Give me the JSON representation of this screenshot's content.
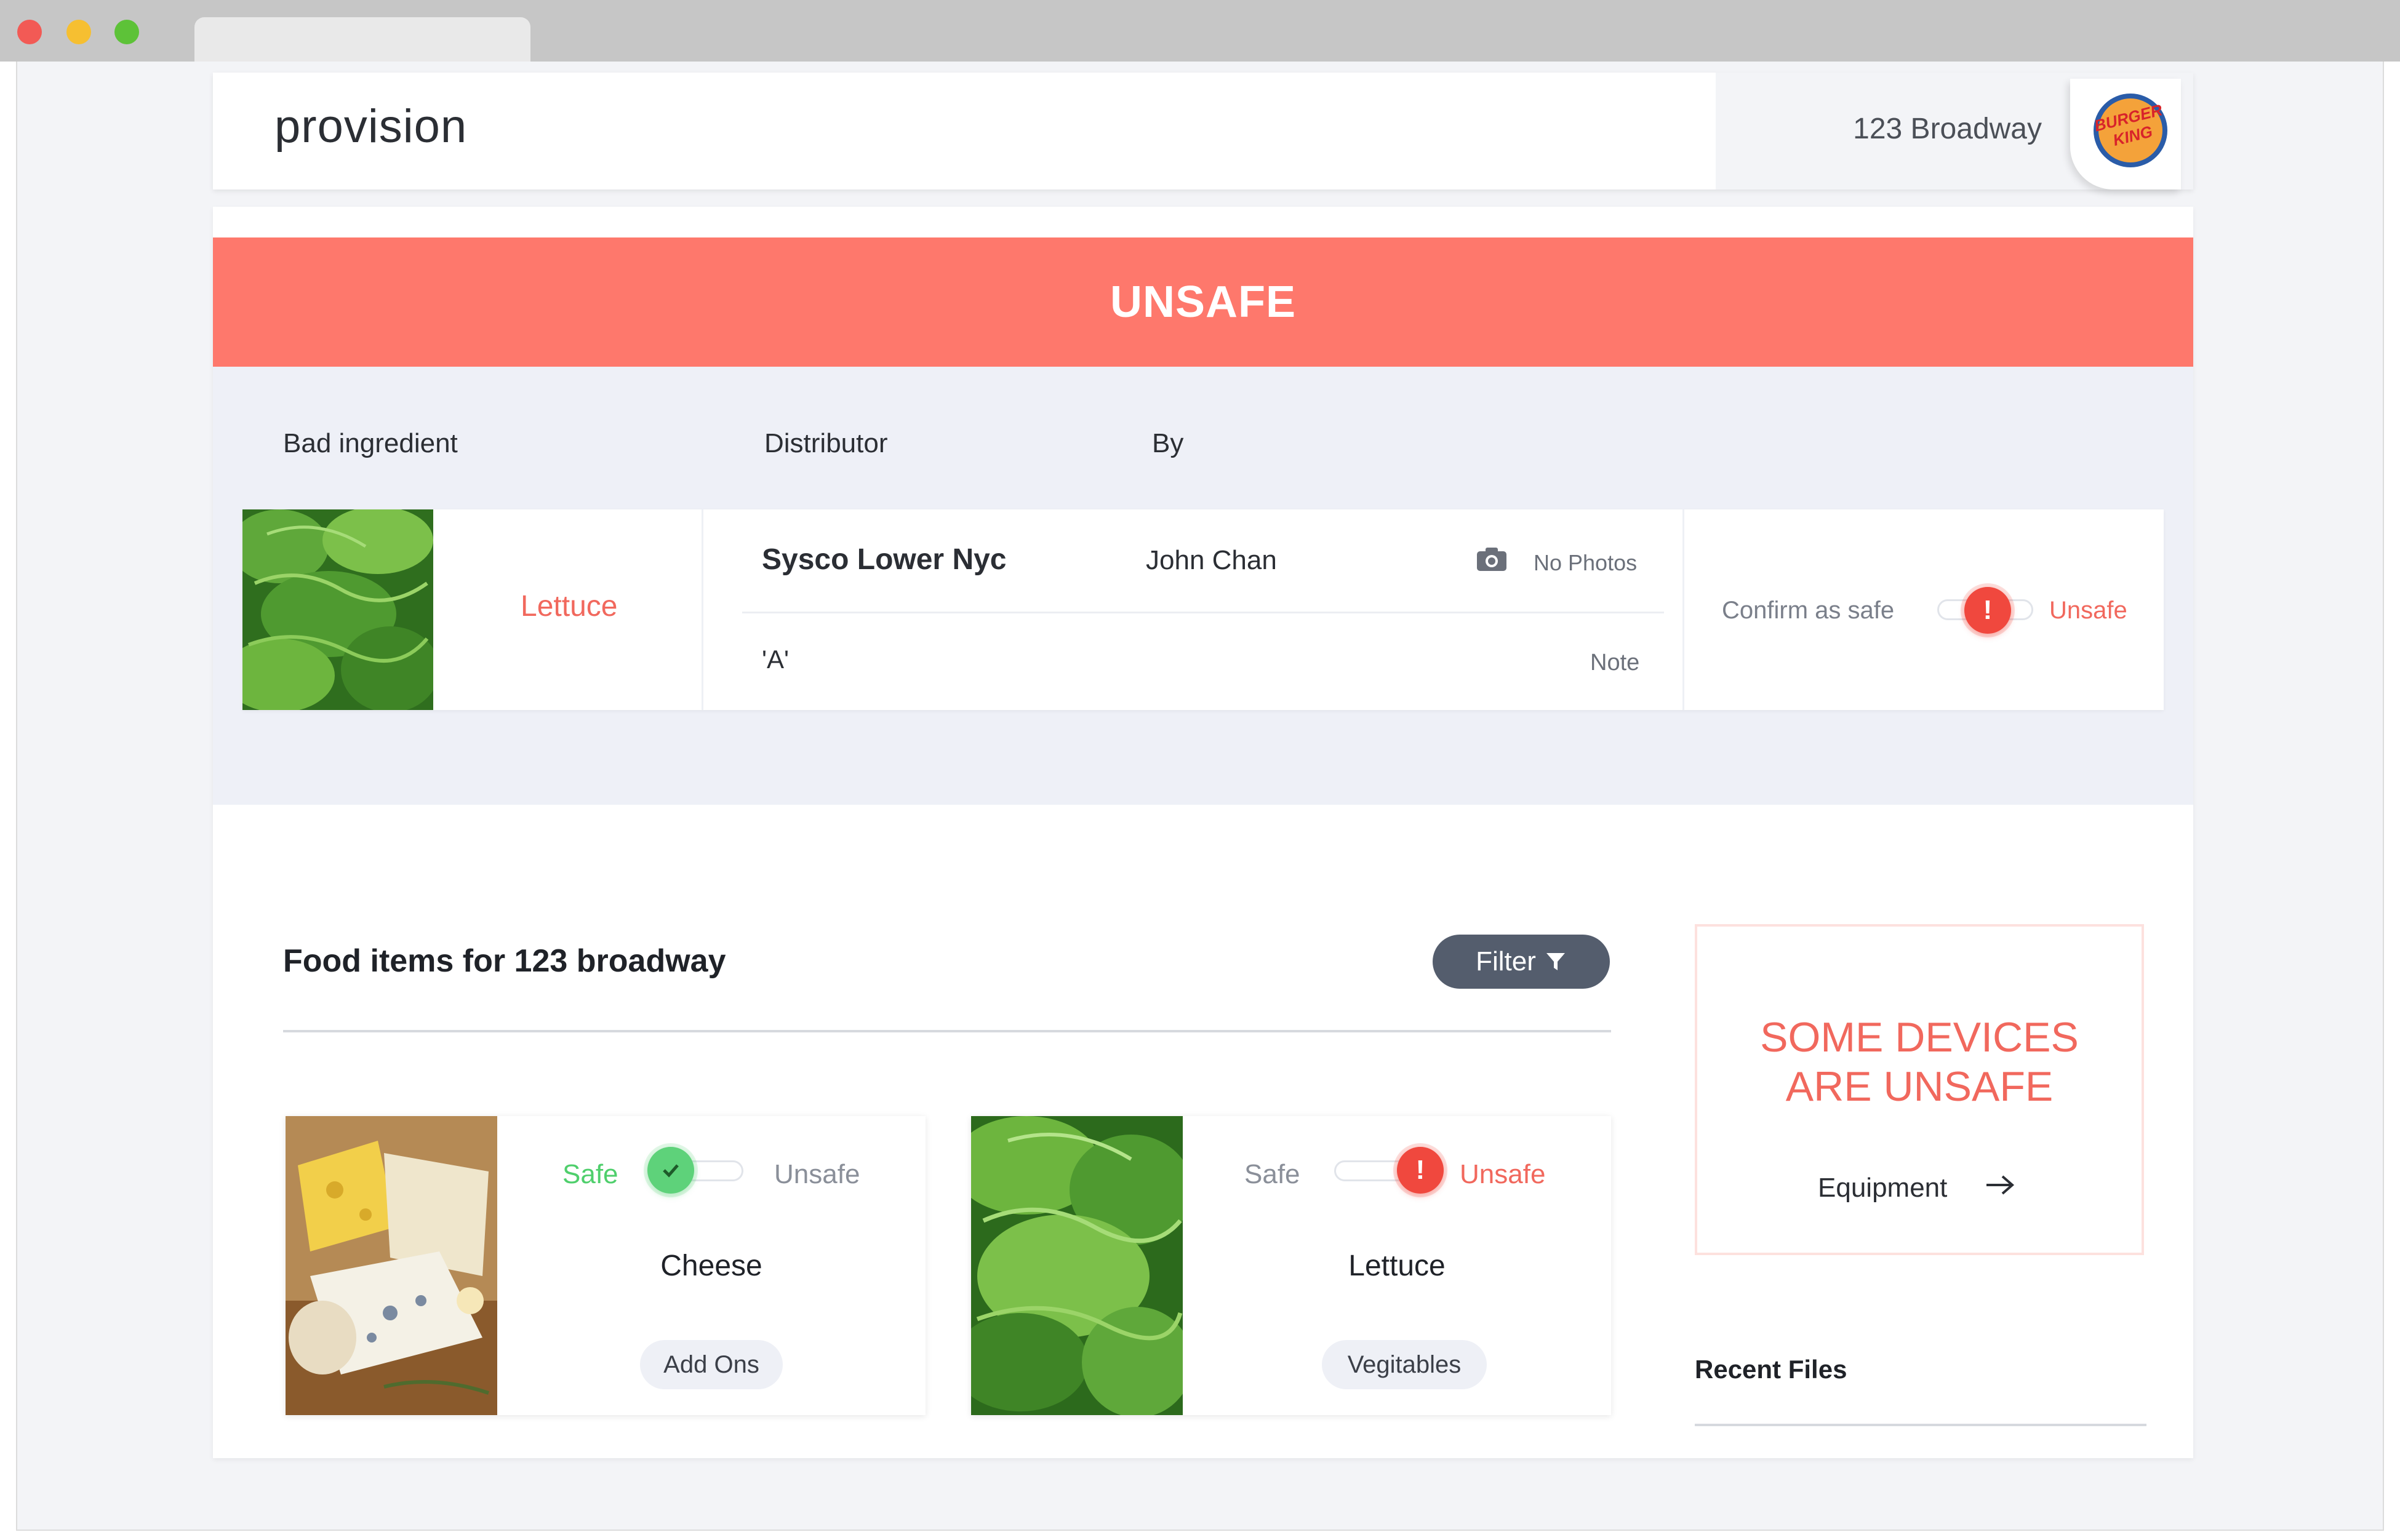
{
  "header": {
    "logo": "provision",
    "location": "123 Broadway",
    "brand_logo_text": "BURGER KING"
  },
  "alert": {
    "banner": "UNSAFE",
    "columns": [
      "Bad ingredient",
      "Distributor",
      "By"
    ],
    "ingredient": "Lettuce",
    "distributor": "Sysco Lower Nyc",
    "by": "John Chan",
    "photos_label": "No Photos",
    "grade": "'A'",
    "note_label": "Note",
    "confirm_label": "Confirm as safe",
    "status_label": "Unsafe",
    "status_icon": "exclamation-icon"
  },
  "food_list": {
    "title": "Food items for 123 broadway",
    "filter_label": "Filter",
    "safe_label": "Safe",
    "unsafe_label": "Unsafe",
    "items": [
      {
        "name": "Cheese",
        "tag": "Add Ons",
        "status": "safe"
      },
      {
        "name": "Lettuce",
        "tag": "Vegitables",
        "status": "unsafe"
      }
    ]
  },
  "devices": {
    "title_line1": "SOME DEVICES",
    "title_line2": "ARE UNSAFE",
    "link": "Equipment"
  },
  "recent_files": {
    "title": "Recent Files"
  },
  "colors": {
    "unsafe": "#fe786c",
    "unsafe_text": "#f1685d",
    "safe": "#5ed27a",
    "filter_button": "#545d6d",
    "alert_bg": "#eef0f7"
  }
}
